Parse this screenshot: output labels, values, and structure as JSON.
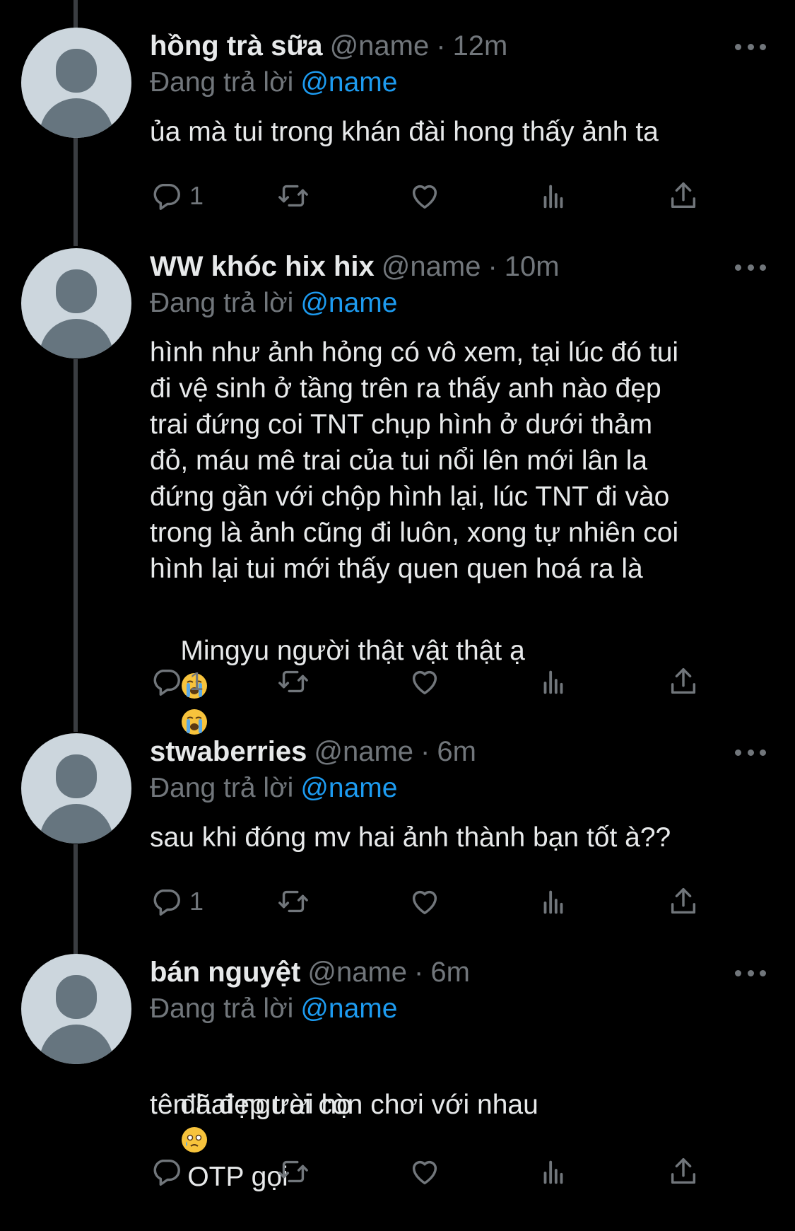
{
  "colors": {
    "background": "#000000",
    "text_primary": "#e7e9ea",
    "text_secondary": "#71767b",
    "mention": "#1d9bf0",
    "thread_line": "#3a3d41",
    "avatar_bg": "#ccd6dd",
    "avatar_fg": "#66757f"
  },
  "icons": {
    "reply": "speech-bubble-icon",
    "retweet": "retweet-arrows-icon",
    "like": "heart-icon",
    "views": "bar-chart-icon",
    "share": "upload-icon",
    "more": "three-dots-icon",
    "emoji_crying": "loudly-crying-face-emoji",
    "emoji_holding_tears": "face-holding-back-tears-emoji"
  },
  "tweets": [
    {
      "display_name": "hồng trà sữa",
      "handle": "@name",
      "time": "12m",
      "replying_label": "Đang trả lời",
      "replying_to": "@name",
      "text": "ủa mà tui trong khán đài hong thấy ảnh ta",
      "reply_count": "1"
    },
    {
      "display_name": "WW khóc hix hix",
      "handle": "@name",
      "time": "10m",
      "replying_label": "Đang trả lời",
      "replying_to": "@name",
      "text": "hình như ảnh hỏng có vô xem, tại lúc đó tui\nđi vệ sinh ở tầng trên ra thấy anh nào đẹp\ntrai đứng coi TNT chụp hình ở dưới thảm\nđỏ, máu mê trai của tui nổi lên mới lân la\nđứng gần với chộp hình lại, lúc TNT đi vào\ntrong là ảnh cũng đi luôn, xong tự nhiên coi\nhình lại tui mới thấy quen quen hoá ra là",
      "text_last": "Mingyu người thật vật thật ạ",
      "reply_count": "1"
    },
    {
      "display_name": "stwaberries",
      "handle": "@name",
      "time": "6m",
      "replying_label": "Đang trả lời",
      "replying_to": "@name",
      "text": "sau khi đóng mv hai ảnh thành bạn tốt à??",
      "reply_count": "1"
    },
    {
      "display_name": "bán nguyệt",
      "handle": "@name",
      "time": "6m",
      "replying_label": "Đang trả lời",
      "replying_to": "@name",
      "text_before_emoji": "đã đẹp trai còn chơi với nhau",
      "text_after_emoji": "OTP gọi",
      "text_line2": "tên hai người họ",
      "reply_count": ""
    }
  ]
}
